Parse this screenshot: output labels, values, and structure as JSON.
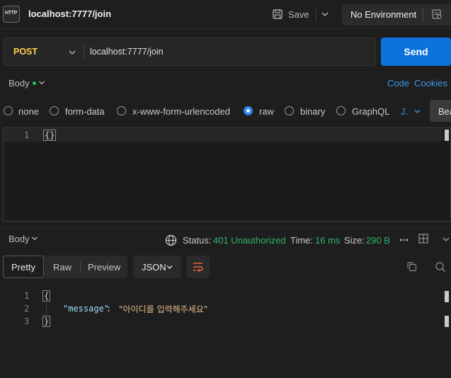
{
  "request": {
    "title": "localhost:7777/join",
    "save_label": "Save",
    "environment": "No Environment",
    "method": "POST",
    "url": "localhost:7777/join",
    "send_label": "Send"
  },
  "request_body": {
    "tab_label": "Body",
    "code_link": "Code",
    "cookies_link": "Cookies",
    "body_types": [
      "none",
      "form-data",
      "x-www-form-urlencoded",
      "raw",
      "binary",
      "GraphQL"
    ],
    "selected_type": "raw",
    "language": "J.",
    "beautify_label": "Bea",
    "line_numbers": [
      "1"
    ],
    "code": "{}"
  },
  "response": {
    "tab_label": "Body",
    "status_label": "Status:",
    "status_value": "401 Unauthorized",
    "time_label": "Time:",
    "time_value": "16 ms",
    "size_label": "Size:",
    "size_value": "290 B",
    "view_tabs": [
      "Pretty",
      "Raw",
      "Preview"
    ],
    "format": "JSON",
    "line_numbers": [
      "1",
      "2",
      "3"
    ],
    "open_brace": "{",
    "close_brace": "}",
    "json_key": "\"message\"",
    "json_colon": ":",
    "json_value": "\"아이디를 입력해주세요\""
  },
  "colors": {
    "accent": "#0b73d9",
    "method": "#ffcf4d",
    "status_ok": "#2fb36d",
    "link": "#3d95e8"
  }
}
